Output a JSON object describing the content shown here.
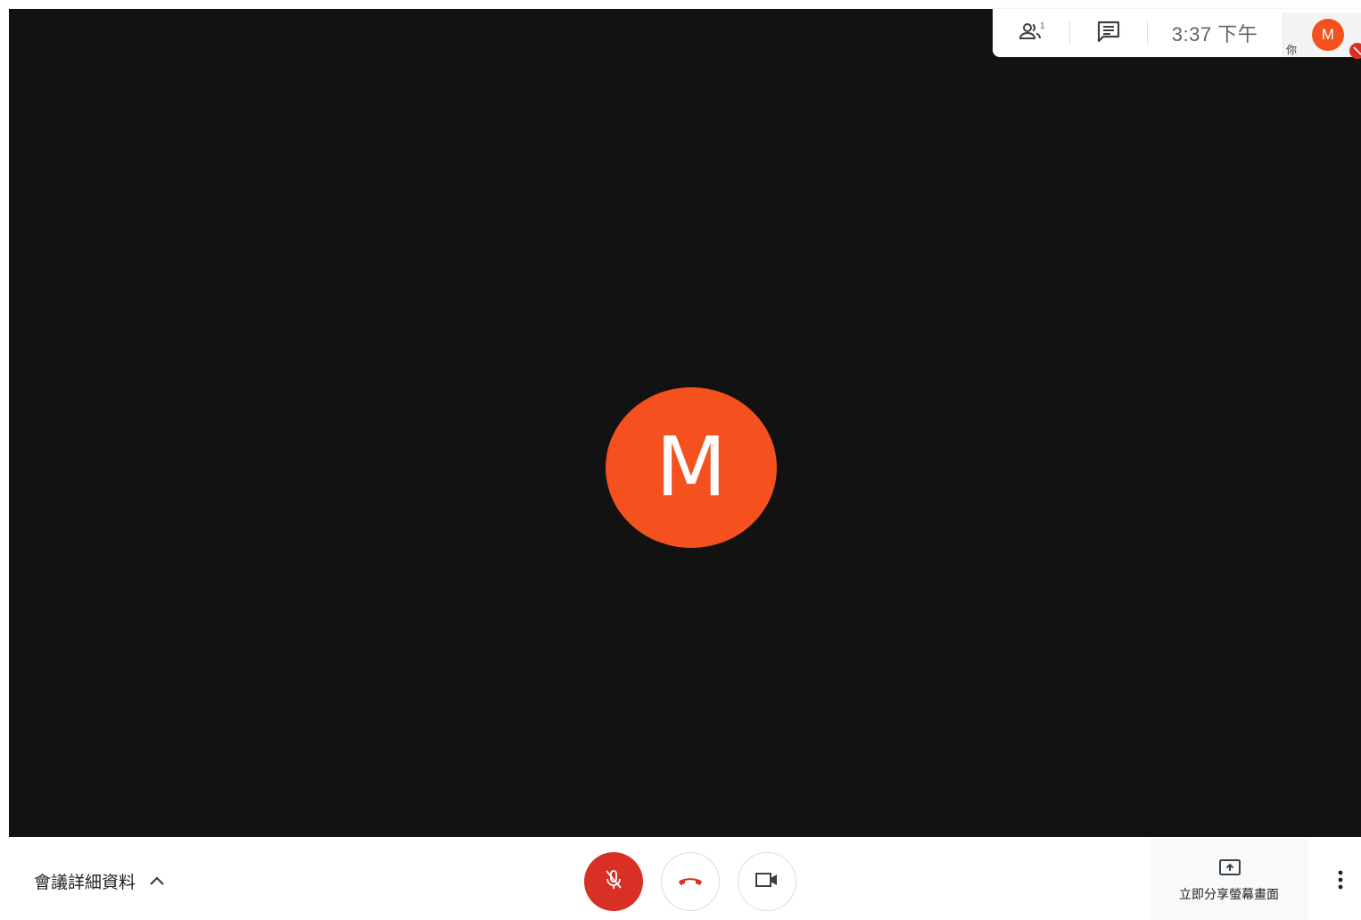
{
  "stage": {
    "avatar_letter": "M",
    "avatar_color": "#f4511e",
    "background_color": "#121212"
  },
  "topbar": {
    "people_icon": "people-icon",
    "people_count": "1",
    "chat_icon": "chat-icon",
    "time": "3:37 下午",
    "self": {
      "label": "你",
      "avatar_letter": "M",
      "status_icon": "muted-badge-icon"
    }
  },
  "bottombar": {
    "details_label": "會議詳細資料",
    "details_icon": "chevron-up-icon",
    "mic": {
      "icon": "mic-off-icon",
      "state": "muted",
      "color": "#d93025"
    },
    "hangup": {
      "icon": "call-end-icon",
      "color": "#d93025"
    },
    "camera": {
      "icon": "videocam-icon"
    },
    "present": {
      "icon": "present-screen-icon",
      "label": "立即分享螢幕畫面"
    },
    "more_icon": "more-vert-icon"
  }
}
